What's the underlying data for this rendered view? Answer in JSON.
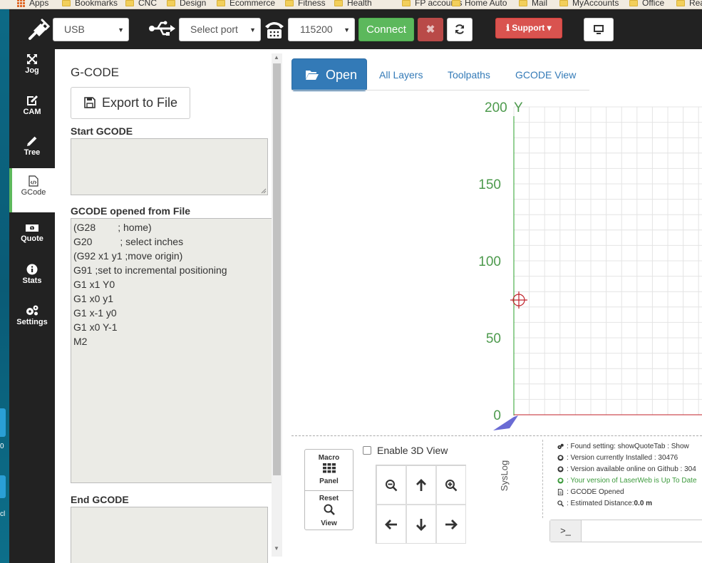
{
  "bookmarks": {
    "items": [
      "Apps",
      "Bookmarks",
      "CNC",
      "Design",
      "Ecommerce",
      "Fitness",
      "Health",
      "FP accounts",
      "Home Auto",
      "Mail",
      "MyAccounts",
      "Office",
      "Rea"
    ]
  },
  "desktop": {
    "fragments": [
      "0",
      "cl"
    ]
  },
  "toolbar": {
    "connection_type": "USB",
    "port_placeholder": "Select port",
    "baud_rate": "115200",
    "connect_label": "Connect",
    "support_label": "Support"
  },
  "nav": {
    "items": [
      {
        "label": "Jog",
        "icon": "arrows-expand-icon"
      },
      {
        "label": "CAM",
        "icon": "edit-icon"
      },
      {
        "label": "Tree",
        "icon": "pencil-icon"
      },
      {
        "label": "GCode",
        "icon": "code-file-icon",
        "active": true
      },
      {
        "label": "Quote",
        "icon": "money-icon"
      },
      {
        "label": "Stats",
        "icon": "info-icon"
      },
      {
        "label": "Settings",
        "icon": "gears-icon"
      }
    ]
  },
  "gcode_panel": {
    "title": "G-CODE",
    "export_label": "Export to File",
    "start_label": "Start GCODE",
    "opened_label": "GCODE opened from File",
    "end_label": "End GCODE",
    "lines": [
      "(G28        ; home)",
      "G20          ; select inches",
      "(G92 x1 y1 ;move origin)",
      "G91 ;set to incremental positioning",
      "G1 x1 Y0",
      "G1 x0 y1",
      "G1 x-1 y0",
      "G1 x0 Y-1",
      "M2"
    ]
  },
  "main": {
    "open_label": "Open",
    "tabs": [
      "All Layers",
      "Toolpaths",
      "GCODE View"
    ],
    "y_axis": {
      "label": "Y",
      "ticks": [
        0,
        50,
        100,
        150,
        200
      ],
      "max": 200
    }
  },
  "bottom": {
    "macro_label_1": "Macro",
    "macro_label_2": "Panel",
    "reset_label_1": "Reset",
    "reset_label_2": "View",
    "enable_3d_label": "Enable 3D View",
    "enable_3d_checked": false,
    "syslog_label": "SysLog",
    "log": [
      {
        "icon": "gears-icon",
        "text": ": Found setting: showQuoteTab : Show",
        "bold": ""
      },
      {
        "icon": "github-icon",
        "text": ": Version currently Installed : 30476",
        "bold": ""
      },
      {
        "icon": "github-icon",
        "text": ": Version available online on Github : 304",
        "bold": ""
      },
      {
        "icon": "github-icon",
        "text": ": Your version of LaserWeb is Up To Date",
        "bold": "",
        "color": "#3c9a3c"
      },
      {
        "icon": "file-icon",
        "text": ": GCODE Opened",
        "bold": ""
      },
      {
        "icon": "search-icon",
        "text": ": Estimated Distance: ",
        "bold": "0.0 m"
      }
    ],
    "terminal_prompt": ">_"
  }
}
